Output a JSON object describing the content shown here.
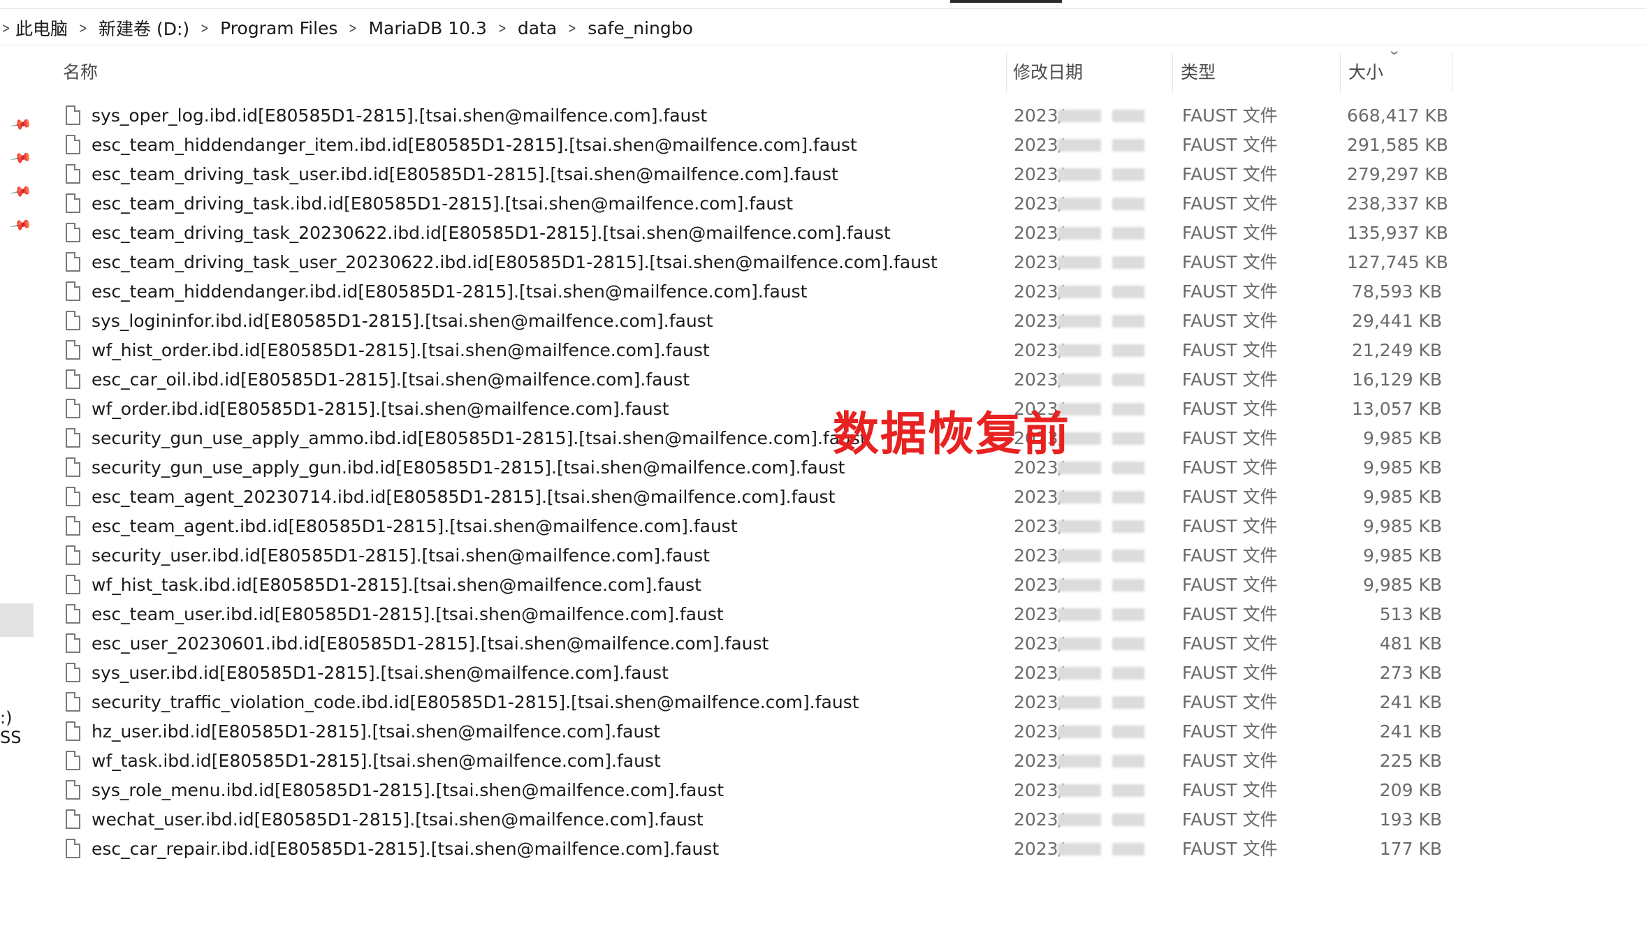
{
  "breadcrumb": {
    "items": [
      "此电脑",
      "新建卷 (D:)",
      "Program Files",
      "MariaDB 10.3",
      "data",
      "safe_ningbo"
    ]
  },
  "header": {
    "name": "名称",
    "date": "修改日期",
    "type": "类型",
    "size": "大小"
  },
  "sidebar": {
    "partial_label": ":) SS"
  },
  "overlay": {
    "text": "数据恢复前"
  },
  "files": [
    {
      "name": "sys_oper_log.ibd.id[E80585D1-2815].[tsai.shen@mailfence.com].faust",
      "date": "2023/",
      "type": "FAUST 文件",
      "size": "668,417 KB"
    },
    {
      "name": "esc_team_hiddendanger_item.ibd.id[E80585D1-2815].[tsai.shen@mailfence.com].faust",
      "date": "2023/",
      "type": "FAUST 文件",
      "size": "291,585 KB"
    },
    {
      "name": "esc_team_driving_task_user.ibd.id[E80585D1-2815].[tsai.shen@mailfence.com].faust",
      "date": "2023/",
      "type": "FAUST 文件",
      "size": "279,297 KB"
    },
    {
      "name": "esc_team_driving_task.ibd.id[E80585D1-2815].[tsai.shen@mailfence.com].faust",
      "date": "2023/",
      "type": "FAUST 文件",
      "size": "238,337 KB"
    },
    {
      "name": "esc_team_driving_task_20230622.ibd.id[E80585D1-2815].[tsai.shen@mailfence.com].faust",
      "date": "2023/",
      "type": "FAUST 文件",
      "size": "135,937 KB"
    },
    {
      "name": "esc_team_driving_task_user_20230622.ibd.id[E80585D1-2815].[tsai.shen@mailfence.com].faust",
      "date": "2023/",
      "type": "FAUST 文件",
      "size": "127,745 KB"
    },
    {
      "name": "esc_team_hiddendanger.ibd.id[E80585D1-2815].[tsai.shen@mailfence.com].faust",
      "date": "2023/",
      "type": "FAUST 文件",
      "size": "78,593 KB"
    },
    {
      "name": "sys_logininfor.ibd.id[E80585D1-2815].[tsai.shen@mailfence.com].faust",
      "date": "2023/",
      "type": "FAUST 文件",
      "size": "29,441 KB"
    },
    {
      "name": "wf_hist_order.ibd.id[E80585D1-2815].[tsai.shen@mailfence.com].faust",
      "date": "2023/",
      "type": "FAUST 文件",
      "size": "21,249 KB"
    },
    {
      "name": "esc_car_oil.ibd.id[E80585D1-2815].[tsai.shen@mailfence.com].faust",
      "date": "2023/",
      "type": "FAUST 文件",
      "size": "16,129 KB"
    },
    {
      "name": "wf_order.ibd.id[E80585D1-2815].[tsai.shen@mailfence.com].faust",
      "date": "2023/",
      "type": "FAUST 文件",
      "size": "13,057 KB"
    },
    {
      "name": "security_gun_use_apply_ammo.ibd.id[E80585D1-2815].[tsai.shen@mailfence.com].faust",
      "date": "2023/",
      "type": "FAUST 文件",
      "size": "9,985 KB"
    },
    {
      "name": "security_gun_use_apply_gun.ibd.id[E80585D1-2815].[tsai.shen@mailfence.com].faust",
      "date": "2023/",
      "type": "FAUST 文件",
      "size": "9,985 KB"
    },
    {
      "name": "esc_team_agent_20230714.ibd.id[E80585D1-2815].[tsai.shen@mailfence.com].faust",
      "date": "2023/",
      "type": "FAUST 文件",
      "size": "9,985 KB"
    },
    {
      "name": "esc_team_agent.ibd.id[E80585D1-2815].[tsai.shen@mailfence.com].faust",
      "date": "2023/",
      "type": "FAUST 文件",
      "size": "9,985 KB"
    },
    {
      "name": "security_user.ibd.id[E80585D1-2815].[tsai.shen@mailfence.com].faust",
      "date": "2023/",
      "type": "FAUST 文件",
      "size": "9,985 KB"
    },
    {
      "name": "wf_hist_task.ibd.id[E80585D1-2815].[tsai.shen@mailfence.com].faust",
      "date": "2023/",
      "type": "FAUST 文件",
      "size": "9,985 KB"
    },
    {
      "name": "esc_team_user.ibd.id[E80585D1-2815].[tsai.shen@mailfence.com].faust",
      "date": "2023/",
      "type": "FAUST 文件",
      "size": "513 KB"
    },
    {
      "name": "esc_user_20230601.ibd.id[E80585D1-2815].[tsai.shen@mailfence.com].faust",
      "date": "2023/",
      "type": "FAUST 文件",
      "size": "481 KB"
    },
    {
      "name": "sys_user.ibd.id[E80585D1-2815].[tsai.shen@mailfence.com].faust",
      "date": "2023/",
      "type": "FAUST 文件",
      "size": "273 KB"
    },
    {
      "name": "security_traffic_violation_code.ibd.id[E80585D1-2815].[tsai.shen@mailfence.com].faust",
      "date": "2023/",
      "type": "FAUST 文件",
      "size": "241 KB"
    },
    {
      "name": "hz_user.ibd.id[E80585D1-2815].[tsai.shen@mailfence.com].faust",
      "date": "2023/",
      "type": "FAUST 文件",
      "size": "241 KB"
    },
    {
      "name": "wf_task.ibd.id[E80585D1-2815].[tsai.shen@mailfence.com].faust",
      "date": "2023/",
      "type": "FAUST 文件",
      "size": "225 KB"
    },
    {
      "name": "sys_role_menu.ibd.id[E80585D1-2815].[tsai.shen@mailfence.com].faust",
      "date": "2023/",
      "type": "FAUST 文件",
      "size": "209 KB"
    },
    {
      "name": "wechat_user.ibd.id[E80585D1-2815].[tsai.shen@mailfence.com].faust",
      "date": "2023/",
      "type": "FAUST 文件",
      "size": "193 KB"
    },
    {
      "name": "esc_car_repair.ibd.id[E80585D1-2815].[tsai.shen@mailfence.com].faust",
      "date": "2023/",
      "type": "FAUST 文件",
      "size": "177 KB"
    }
  ]
}
